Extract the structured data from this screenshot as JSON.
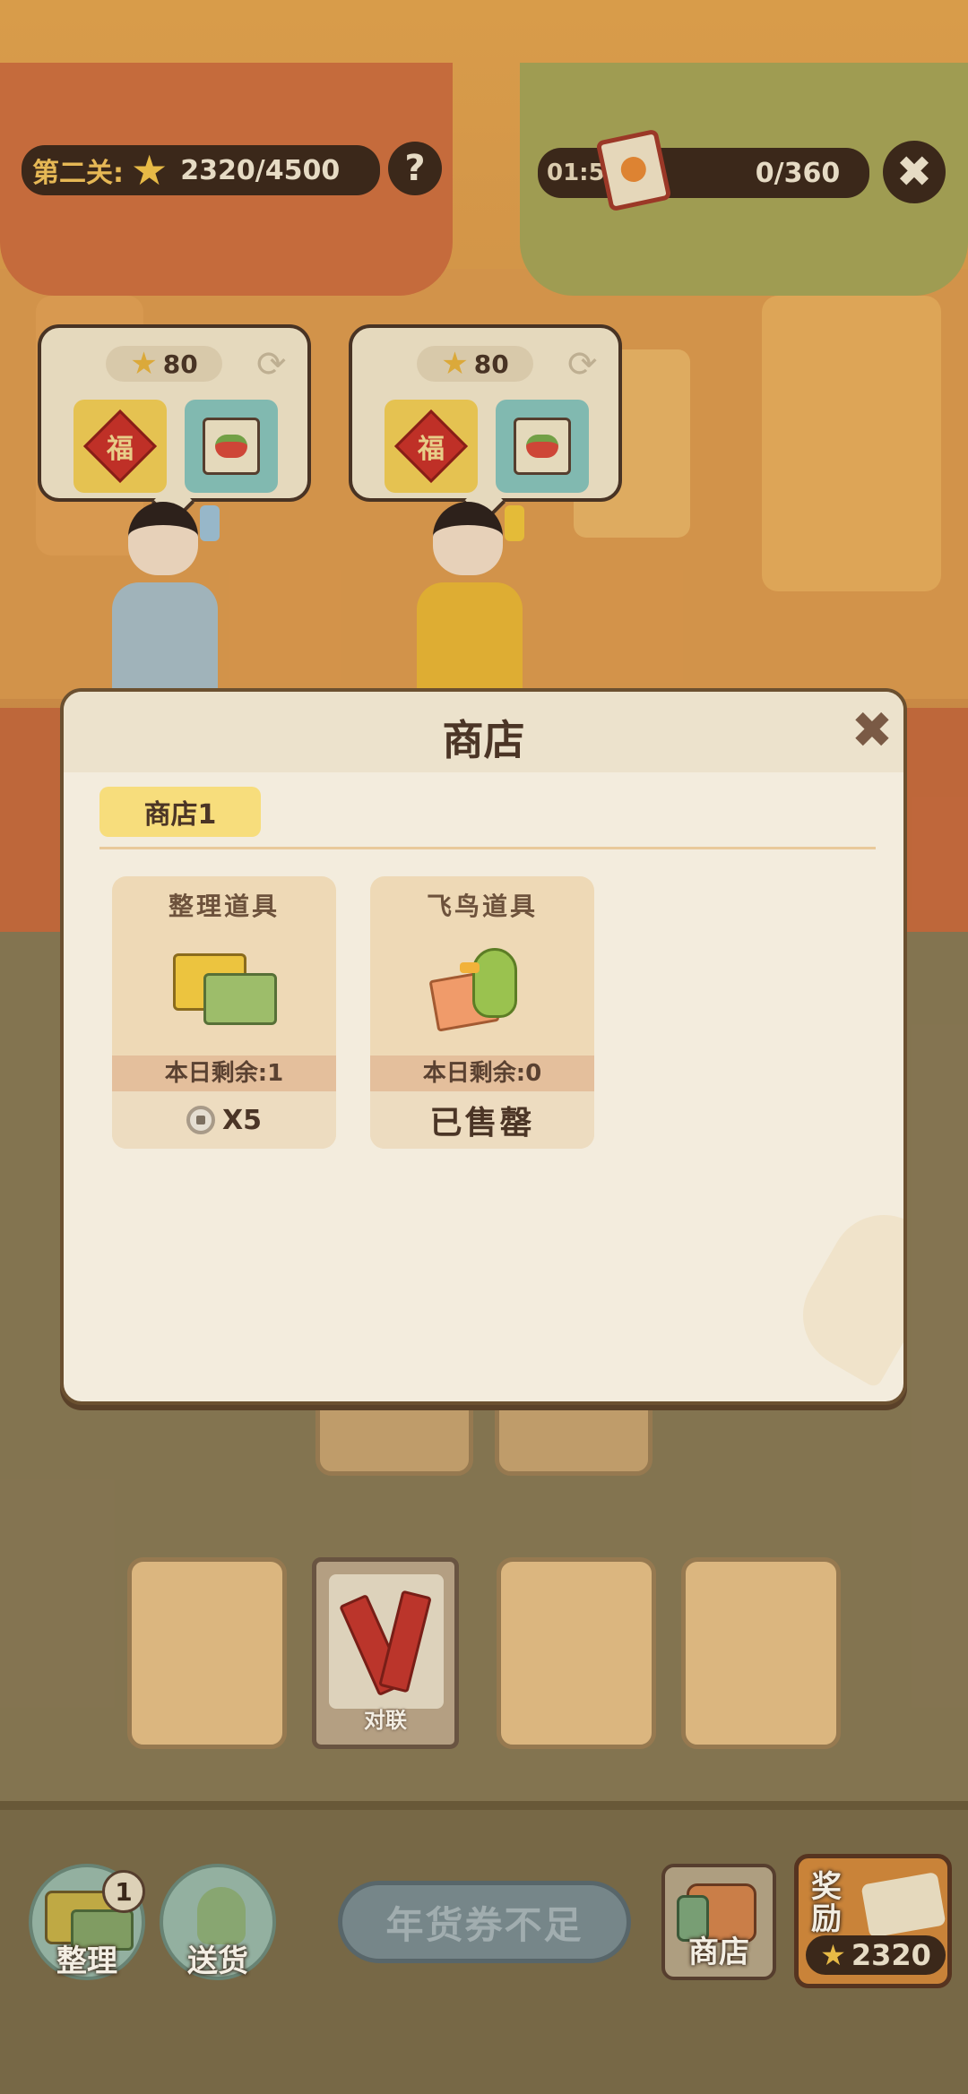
{
  "hud": {
    "level_label": "第二关:",
    "score_progress": "2320/4500",
    "help_symbol": "?",
    "timer": "01:54",
    "delivery_progress": "0/360",
    "close_symbol": "✖"
  },
  "customers": [
    {
      "cost": "80",
      "wants": [
        "福",
        "vegetable-icon"
      ]
    },
    {
      "cost": "80",
      "wants": [
        "福",
        "vegetable-icon"
      ]
    }
  ],
  "board": {
    "couplet_label": "对联"
  },
  "shop_modal": {
    "title": "商店",
    "close_symbol": "✖",
    "tabs": [
      "商店1"
    ],
    "items": [
      {
        "name": "整理道具",
        "stock": "本日剩余:1",
        "price": "X5",
        "sold_out": false,
        "icon": "sort-boxes-icon"
      },
      {
        "name": "飞鸟道具",
        "stock": "本日剩余:0",
        "price": "已售罄",
        "sold_out": true,
        "icon": "bird-icon"
      }
    ]
  },
  "bottom_bar": {
    "sort_label": "整理",
    "sort_badge": "1",
    "deliver_label": "送货",
    "insufficient_label": "年货券不足",
    "shop_label": "商店",
    "reward_label": "奖励",
    "reward_amount": "2320"
  },
  "colors": {
    "accent_gold": "#f3c34a",
    "hud_dark": "#3e2a1c",
    "modal_bg": "#f3ecdd",
    "tab_yellow": "#f7dd7c"
  }
}
